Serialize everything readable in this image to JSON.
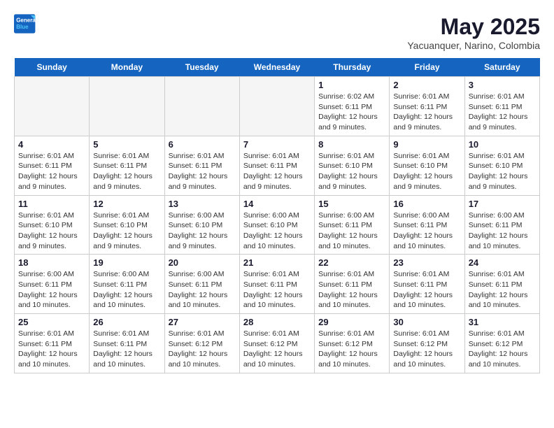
{
  "header": {
    "logo_line1": "General",
    "logo_line2": "Blue",
    "month_title": "May 2025",
    "subtitle": "Yacuanquer, Narino, Colombia"
  },
  "days_of_week": [
    "Sunday",
    "Monday",
    "Tuesday",
    "Wednesday",
    "Thursday",
    "Friday",
    "Saturday"
  ],
  "weeks": [
    [
      {
        "day": "",
        "info": ""
      },
      {
        "day": "",
        "info": ""
      },
      {
        "day": "",
        "info": ""
      },
      {
        "day": "",
        "info": ""
      },
      {
        "day": "1",
        "info": "Sunrise: 6:02 AM\nSunset: 6:11 PM\nDaylight: 12 hours and 9 minutes."
      },
      {
        "day": "2",
        "info": "Sunrise: 6:01 AM\nSunset: 6:11 PM\nDaylight: 12 hours and 9 minutes."
      },
      {
        "day": "3",
        "info": "Sunrise: 6:01 AM\nSunset: 6:11 PM\nDaylight: 12 hours and 9 minutes."
      }
    ],
    [
      {
        "day": "4",
        "info": "Sunrise: 6:01 AM\nSunset: 6:11 PM\nDaylight: 12 hours and 9 minutes."
      },
      {
        "day": "5",
        "info": "Sunrise: 6:01 AM\nSunset: 6:11 PM\nDaylight: 12 hours and 9 minutes."
      },
      {
        "day": "6",
        "info": "Sunrise: 6:01 AM\nSunset: 6:11 PM\nDaylight: 12 hours and 9 minutes."
      },
      {
        "day": "7",
        "info": "Sunrise: 6:01 AM\nSunset: 6:11 PM\nDaylight: 12 hours and 9 minutes."
      },
      {
        "day": "8",
        "info": "Sunrise: 6:01 AM\nSunset: 6:10 PM\nDaylight: 12 hours and 9 minutes."
      },
      {
        "day": "9",
        "info": "Sunrise: 6:01 AM\nSunset: 6:10 PM\nDaylight: 12 hours and 9 minutes."
      },
      {
        "day": "10",
        "info": "Sunrise: 6:01 AM\nSunset: 6:10 PM\nDaylight: 12 hours and 9 minutes."
      }
    ],
    [
      {
        "day": "11",
        "info": "Sunrise: 6:01 AM\nSunset: 6:10 PM\nDaylight: 12 hours and 9 minutes."
      },
      {
        "day": "12",
        "info": "Sunrise: 6:01 AM\nSunset: 6:10 PM\nDaylight: 12 hours and 9 minutes."
      },
      {
        "day": "13",
        "info": "Sunrise: 6:00 AM\nSunset: 6:10 PM\nDaylight: 12 hours and 9 minutes."
      },
      {
        "day": "14",
        "info": "Sunrise: 6:00 AM\nSunset: 6:10 PM\nDaylight: 12 hours and 10 minutes."
      },
      {
        "day": "15",
        "info": "Sunrise: 6:00 AM\nSunset: 6:11 PM\nDaylight: 12 hours and 10 minutes."
      },
      {
        "day": "16",
        "info": "Sunrise: 6:00 AM\nSunset: 6:11 PM\nDaylight: 12 hours and 10 minutes."
      },
      {
        "day": "17",
        "info": "Sunrise: 6:00 AM\nSunset: 6:11 PM\nDaylight: 12 hours and 10 minutes."
      }
    ],
    [
      {
        "day": "18",
        "info": "Sunrise: 6:00 AM\nSunset: 6:11 PM\nDaylight: 12 hours and 10 minutes."
      },
      {
        "day": "19",
        "info": "Sunrise: 6:00 AM\nSunset: 6:11 PM\nDaylight: 12 hours and 10 minutes."
      },
      {
        "day": "20",
        "info": "Sunrise: 6:00 AM\nSunset: 6:11 PM\nDaylight: 12 hours and 10 minutes."
      },
      {
        "day": "21",
        "info": "Sunrise: 6:01 AM\nSunset: 6:11 PM\nDaylight: 12 hours and 10 minutes."
      },
      {
        "day": "22",
        "info": "Sunrise: 6:01 AM\nSunset: 6:11 PM\nDaylight: 12 hours and 10 minutes."
      },
      {
        "day": "23",
        "info": "Sunrise: 6:01 AM\nSunset: 6:11 PM\nDaylight: 12 hours and 10 minutes."
      },
      {
        "day": "24",
        "info": "Sunrise: 6:01 AM\nSunset: 6:11 PM\nDaylight: 12 hours and 10 minutes."
      }
    ],
    [
      {
        "day": "25",
        "info": "Sunrise: 6:01 AM\nSunset: 6:11 PM\nDaylight: 12 hours and 10 minutes."
      },
      {
        "day": "26",
        "info": "Sunrise: 6:01 AM\nSunset: 6:11 PM\nDaylight: 12 hours and 10 minutes."
      },
      {
        "day": "27",
        "info": "Sunrise: 6:01 AM\nSunset: 6:12 PM\nDaylight: 12 hours and 10 minutes."
      },
      {
        "day": "28",
        "info": "Sunrise: 6:01 AM\nSunset: 6:12 PM\nDaylight: 12 hours and 10 minutes."
      },
      {
        "day": "29",
        "info": "Sunrise: 6:01 AM\nSunset: 6:12 PM\nDaylight: 12 hours and 10 minutes."
      },
      {
        "day": "30",
        "info": "Sunrise: 6:01 AM\nSunset: 6:12 PM\nDaylight: 12 hours and 10 minutes."
      },
      {
        "day": "31",
        "info": "Sunrise: 6:01 AM\nSunset: 6:12 PM\nDaylight: 12 hours and 10 minutes."
      }
    ]
  ]
}
